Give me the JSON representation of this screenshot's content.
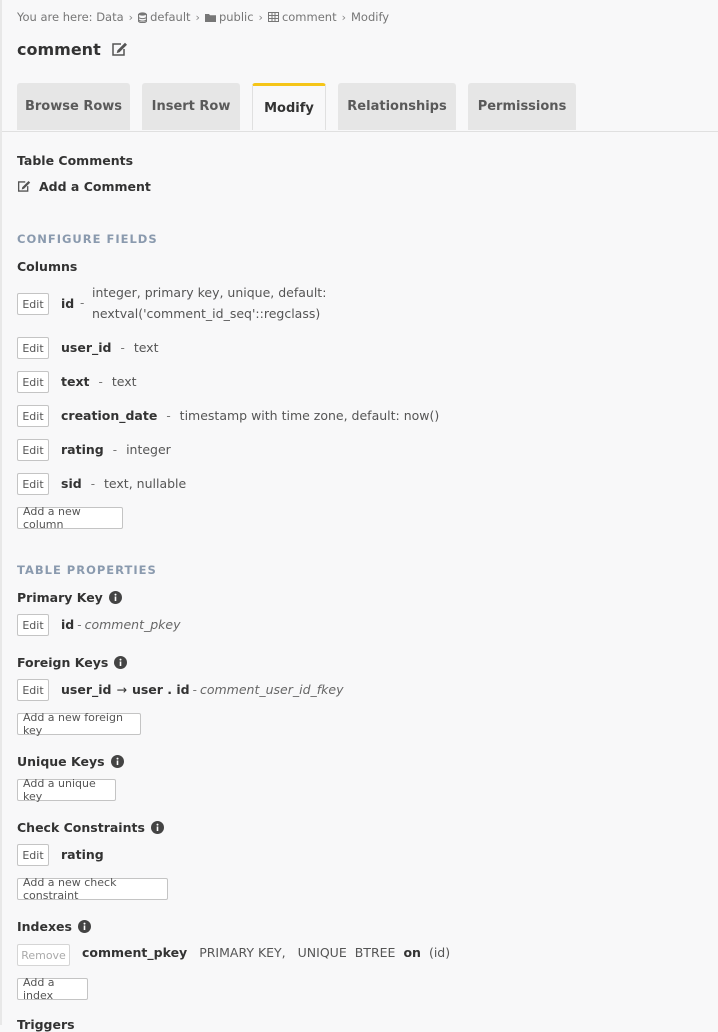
{
  "breadcrumb": {
    "prefix": "You are here:",
    "items": [
      "Data",
      "default",
      "public",
      "comment",
      "Modify"
    ]
  },
  "title": "comment",
  "tabs": [
    {
      "label": "Browse Rows",
      "active": false
    },
    {
      "label": "Insert Row",
      "active": false
    },
    {
      "label": "Modify",
      "active": true
    },
    {
      "label": "Relationships",
      "active": false
    },
    {
      "label": "Permissions",
      "active": false
    }
  ],
  "table_comments": {
    "heading": "Table Comments",
    "add_label": "Add a Comment"
  },
  "configure_fields": {
    "heading": "CONFIGURE FIELDS",
    "columns_heading": "Columns",
    "edit_label": "Edit",
    "columns": [
      {
        "name": "id",
        "type_line1": "integer, primary key, unique, default:",
        "type_line2": "nextval('comment_id_seq'::regclass)"
      },
      {
        "name": "user_id",
        "type": "text"
      },
      {
        "name": "text",
        "type": "text"
      },
      {
        "name": "creation_date",
        "type": "timestamp with time zone, default: now()"
      },
      {
        "name": "rating",
        "type": "integer"
      },
      {
        "name": "sid",
        "type": "text, nullable"
      }
    ],
    "add_column_label": "Add a new column"
  },
  "table_properties": {
    "heading": "TABLE PROPERTIES",
    "primary_key": {
      "heading": "Primary Key",
      "column": "id",
      "constraint": "comment_pkey"
    },
    "foreign_keys": {
      "heading": "Foreign Keys",
      "items": [
        {
          "from": "user_id",
          "arrow": "→",
          "to": "user . id",
          "constraint": "comment_user_id_fkey"
        }
      ],
      "add_label": "Add a new foreign key"
    },
    "unique_keys": {
      "heading": "Unique Keys",
      "add_label": "Add a unique key"
    },
    "check_constraints": {
      "heading": "Check Constraints",
      "items": [
        {
          "name": "rating"
        }
      ],
      "add_label": "Add a new check constraint"
    },
    "indexes": {
      "heading": "Indexes",
      "remove_label": "Remove",
      "items": [
        {
          "name": "comment_pkey",
          "type1": "PRIMARY KEY,",
          "type2": "UNIQUE",
          "method": "BTREE",
          "on": "on",
          "columns": "(id)"
        }
      ],
      "add_label": "Add a index"
    },
    "triggers_heading": "Triggers"
  },
  "colors": {
    "accent": "#f5c518",
    "section": "#8a9aae",
    "background": "#f8f8f9"
  }
}
